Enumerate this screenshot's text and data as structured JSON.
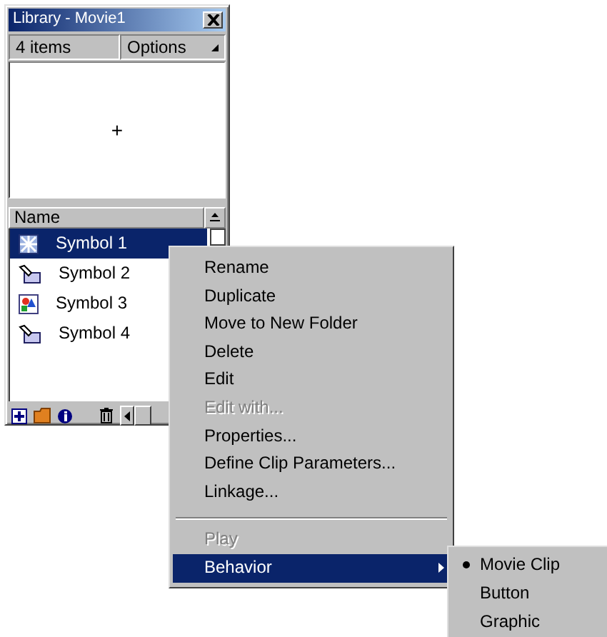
{
  "window": {
    "title": "Library - Movie1"
  },
  "toolbar": {
    "count": "4 items",
    "options": "Options"
  },
  "preview": {
    "crosshair": "+"
  },
  "list": {
    "column": "Name",
    "items": [
      {
        "name": "Symbol 1",
        "kind": "movie",
        "selected": true
      },
      {
        "name": "Symbol 2",
        "kind": "button",
        "selected": false
      },
      {
        "name": "Symbol 3",
        "kind": "graphic",
        "selected": false
      },
      {
        "name": "Symbol 4",
        "kind": "button",
        "selected": false
      }
    ]
  },
  "context_menu": [
    {
      "kind": "item",
      "label": "Rename",
      "disabled": false
    },
    {
      "kind": "item",
      "label": "Duplicate",
      "disabled": false
    },
    {
      "kind": "item",
      "label": "Move to New Folder",
      "disabled": false
    },
    {
      "kind": "item",
      "label": "Delete",
      "disabled": false
    },
    {
      "kind": "item",
      "label": "Edit",
      "disabled": false
    },
    {
      "kind": "item",
      "label": "Edit with...",
      "disabled": true
    },
    {
      "kind": "item",
      "label": "Properties...",
      "disabled": false
    },
    {
      "kind": "item",
      "label": "Define Clip Parameters...",
      "disabled": false
    },
    {
      "kind": "item",
      "label": "Linkage...",
      "disabled": false
    },
    {
      "kind": "separator"
    },
    {
      "kind": "item",
      "label": "Play",
      "disabled": true
    },
    {
      "kind": "submenu",
      "label": "Behavior",
      "disabled": false,
      "selected": true
    }
  ],
  "submenu": [
    {
      "label": "Movie Clip",
      "checked": true
    },
    {
      "label": "Button",
      "checked": false
    },
    {
      "label": "Graphic",
      "checked": false
    }
  ]
}
